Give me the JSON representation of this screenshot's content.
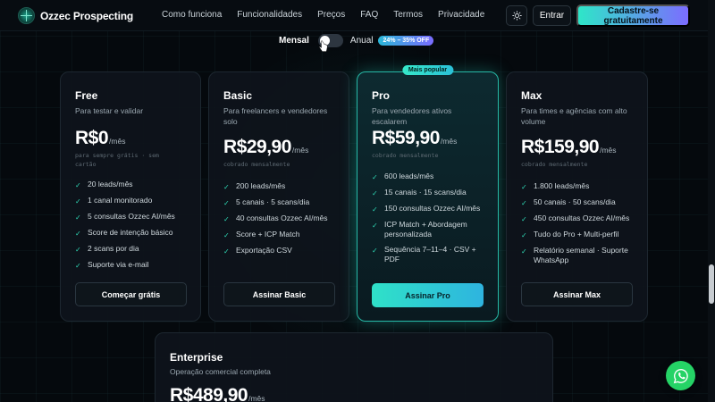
{
  "brand": {
    "name": "Ozzec Prospecting",
    "logo_icon": "ozzec-logo-icon"
  },
  "nav": {
    "links": [
      "Como funciona",
      "Funcionalidades",
      "Preços",
      "FAQ",
      "Termos",
      "Privacidade"
    ],
    "theme_icon": "sun-icon",
    "login_label": "Entrar",
    "signup_label": "Cadastre-se gratuitamente"
  },
  "billing": {
    "monthly_label": "Mensal",
    "annual_label": "Anual",
    "discount_badge": "24% – 35% OFF",
    "selected": "Mensal"
  },
  "plans": [
    {
      "name": "Free",
      "description": "Para testar e validar",
      "price": "R$0",
      "period": "/mês",
      "note": "para sempre grátis · sem cartão",
      "features": [
        "20 leads/mês",
        "1 canal monitorado",
        "5 consultas Ozzec AI/mês",
        "Score de intenção básico",
        "2 scans por dia",
        "Suporte via e-mail"
      ],
      "button": "Começar grátis"
    },
    {
      "name": "Basic",
      "description": "Para freelancers e vendedores solo",
      "price": "R$29,90",
      "period": "/mês",
      "note": "cobrado mensalmente",
      "features": [
        "200 leads/mês",
        "5 canais · 5 scans/dia",
        "40 consultas Ozzec AI/mês",
        "Score + ICP Match",
        "Exportação CSV"
      ],
      "button": "Assinar Basic"
    },
    {
      "name": "Pro",
      "badge": "Mais popular",
      "description": "Para vendedores ativos escalarem",
      "price": "R$59,90",
      "period": "/mês",
      "note": "cobrado mensalmente",
      "features": [
        "600 leads/mês",
        "15 canais · 15 scans/dia",
        "150 consultas Ozzec AI/mês",
        "ICP Match + Abordagem personalizada",
        "Sequência 7–11–4 · CSV + PDF"
      ],
      "button": "Assinar Pro"
    },
    {
      "name": "Max",
      "description": "Para times e agências com alto volume",
      "price": "R$159,90",
      "period": "/mês",
      "note": "cobrado mensalmente",
      "features": [
        "1.800 leads/mês",
        "50 canais · 50 scans/dia",
        "450 consultas Ozzec AI/mês",
        "Tudo do Pro + Multi-perfil",
        "Relatório semanal · Suporte WhatsApp"
      ],
      "button": "Assinar Max"
    }
  ],
  "enterprise": {
    "name": "Enterprise",
    "description": "Operação comercial completa",
    "price": "R$489,90",
    "period": "/mês"
  },
  "floating": {
    "whatsapp_icon": "whatsapp-icon"
  },
  "colors": {
    "accent_teal": "#2fe1c8",
    "accent_violet": "#7c6cff",
    "background": "#05090d"
  }
}
